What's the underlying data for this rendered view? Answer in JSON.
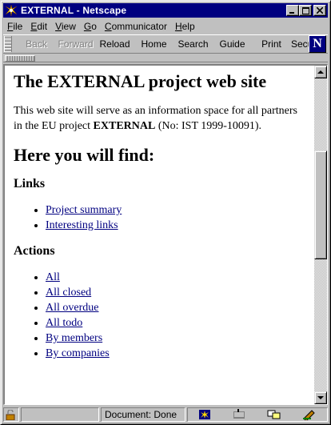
{
  "window": {
    "title": "EXTERNAL - Netscape"
  },
  "menubar": {
    "items": [
      {
        "hot": "F",
        "rest": "ile"
      },
      {
        "hot": "E",
        "rest": "dit"
      },
      {
        "hot": "V",
        "rest": "iew"
      },
      {
        "hot": "G",
        "rest": "o"
      },
      {
        "hot": "C",
        "rest": "ommunicator"
      },
      {
        "hot": "H",
        "rest": "elp"
      }
    ]
  },
  "toolbar": {
    "back": "Back",
    "forward": "Forward",
    "reload": "Reload",
    "home": "Home",
    "search": "Search",
    "guide": "Guide",
    "print": "Print",
    "security": "Secu"
  },
  "page": {
    "heading": "The EXTERNAL project web site",
    "intro_before": "This web site will serve as an information space for all partners in the EU project ",
    "intro_bold": "EXTERNAL",
    "intro_after": " (No: IST 1999-10091).",
    "find_heading": "Here you will find:",
    "links_heading": "Links",
    "links": [
      "Project summary",
      "Interesting links"
    ],
    "actions_heading": "Actions",
    "actions": [
      "All ",
      "All closed ",
      "All overdue ",
      "All todo ",
      "By members",
      "By companies"
    ]
  },
  "statusbar": {
    "status": "Document: Done"
  },
  "colors": {
    "titlebar": "#000080",
    "link": "#000080",
    "chrome": "#c0c0c0"
  }
}
